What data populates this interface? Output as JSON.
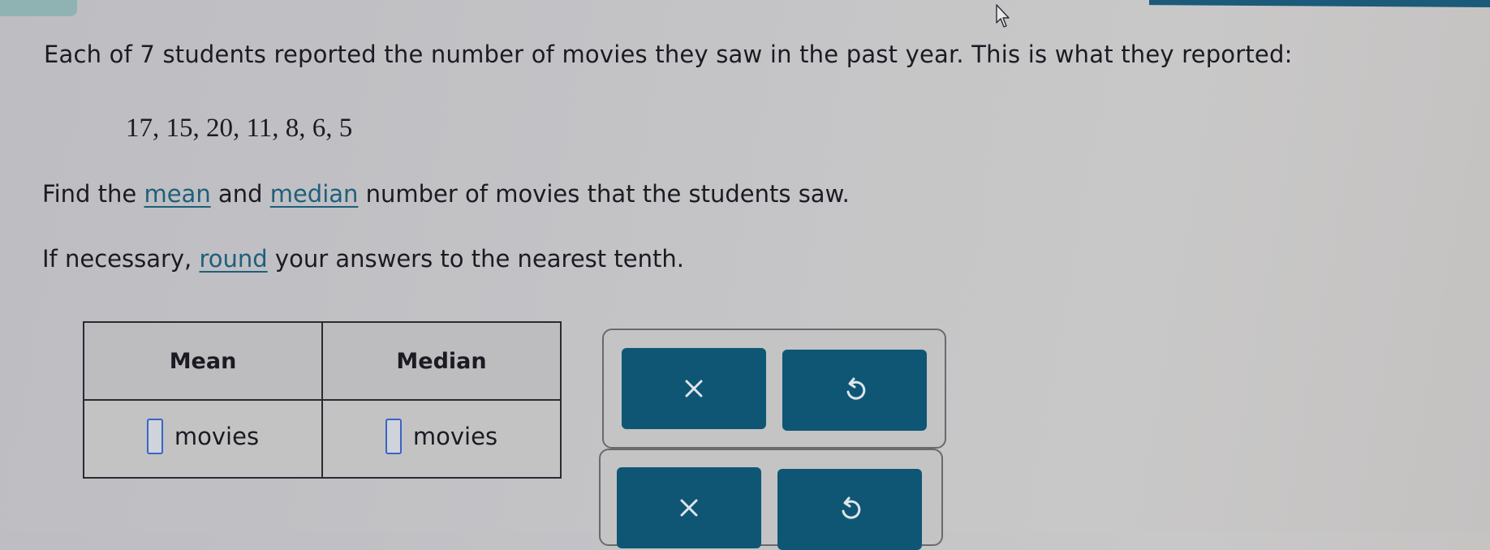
{
  "question": {
    "prompt": "Each of 7 students reported the number of movies they saw in the past year. This is what they reported:",
    "data_values_text": "17, 15, 20, 11, 8, 6, 5",
    "data_values": [
      17,
      15,
      20,
      11,
      8,
      6,
      5
    ]
  },
  "instructions": {
    "line1": {
      "part1": "Find the ",
      "link_mean": "mean",
      "part2": " and ",
      "link_median": "median",
      "part3": " number of movies that the students saw."
    },
    "line2": {
      "part1": "If necessary, ",
      "link_round": "round",
      "part2": " your answers to the nearest tenth."
    }
  },
  "answer_table": {
    "headers": [
      "Mean",
      "Median"
    ],
    "cells": [
      {
        "value": "",
        "unit": "movies"
      },
      {
        "value": "",
        "unit": "movies"
      }
    ]
  },
  "actions": {
    "panels": [
      {
        "clear_icon": "x-icon",
        "undo_icon": "undo-icon"
      },
      {
        "clear_icon": "x-icon",
        "undo_icon": "undo-icon"
      }
    ]
  },
  "colors": {
    "button_bg": "#0f5675",
    "link": "#1f5f7a",
    "input_border": "#3a64c8",
    "top_bar": "#1b5a78"
  }
}
